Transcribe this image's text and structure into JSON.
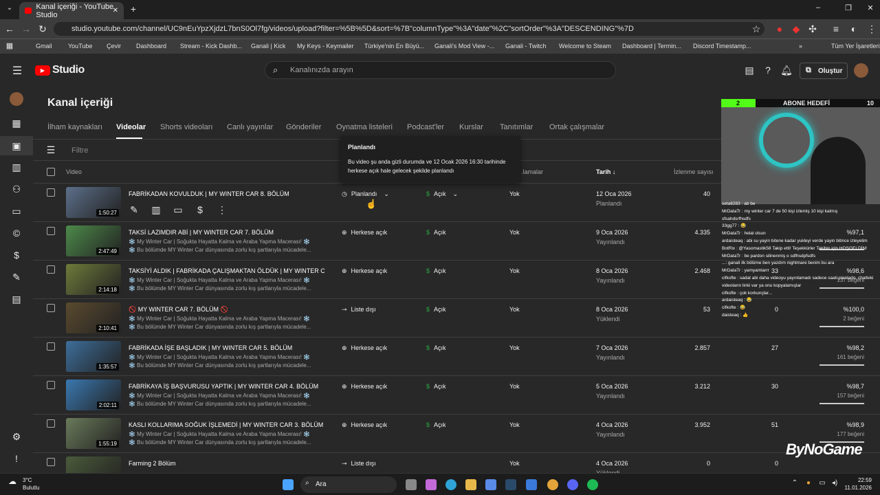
{
  "browser": {
    "tab_title": "Kanal içeriği - YouTube Studio",
    "url": "studio.youtube.com/channel/UC9nEuYpzXjdzL7bnS0Ol7fg/videos/upload?filter=%5B%5D&sort=%7B\"columnType\"%3A\"date\"%2C\"sortOrder\"%3A\"DESCENDING\"%7D",
    "bookmarks": [
      "Gmail",
      "YouTube",
      "Çevir",
      "Dashboard",
      "Stream - Kick Dashb...",
      "Ganali | Kick",
      "My Keys - Keymailer",
      "Türkiye'nin En Büyü...",
      "Ganali's Mod View -...",
      "Ganali - Twitch",
      "Welcome to Steam",
      "Dashboard | Termin...",
      "Discord Timestamp..."
    ],
    "bookmarks_more": "Tüm Yer İşaretleri"
  },
  "header": {
    "logo": "Studio",
    "search_placeholder": "Kanalınızda arayın",
    "create_label": "Oluştur"
  },
  "page": {
    "title": "Kanal içeriği",
    "tabs": [
      "İlham kaynakları",
      "Videolar",
      "Shorts videoları",
      "Canlı yayınlar",
      "Gönderiler",
      "Oynatma listeleri",
      "Podcast'ler",
      "Kurslar",
      "Tanıtımlar",
      "Ortak çalışmalar"
    ],
    "filter_placeholder": "Filtre"
  },
  "columns": {
    "video": "Video",
    "restrictions": "...lamalar",
    "date": "Tarih",
    "views": "İzlenme sayısı"
  },
  "tooltip": {
    "title": "Planlandı",
    "body": "Bu video şu anda gizli durumda ve 12 Ocak 2026 16:30 tarihinde herkese açık hale gelecek şekilde planlandı"
  },
  "rows": [
    {
      "title": "FABRİKADAN KOVULDUK | MY WINTER CAR 8. BÖLÜM",
      "desc1": "",
      "desc2": "",
      "duration": "1:50:27",
      "visibility": "Planlandı",
      "monet": "Açık",
      "restriction": "Yok",
      "date": "12 Oca 2026",
      "date_status": "Planlandı",
      "views": "40",
      "comments": "",
      "likes": "",
      "likes_sub": "",
      "thumb": "#5c6f8a"
    },
    {
      "title": "TAKSİ LAZIMDIR ABİ | MY WINTER CAR 7. BÖLÜM",
      "desc1": "❄️ My Winter Car | Soğukta Hayatta Kalma ve Araba Yapma Macerası! ❄️",
      "desc2": "❄️ Bu bölümde MY Winter Car dünyasında zorlu kış şartlarıyla mücadele...",
      "duration": "2:47:49",
      "visibility": "Herkese açık",
      "monet": "Açık",
      "restriction": "Yok",
      "date": "9 Oca 2026",
      "date_status": "Yayınlandı",
      "views": "4.335",
      "comments": "",
      "likes": "%97,1",
      "likes_sub": "",
      "thumb": "#4d8a4a"
    },
    {
      "title": "TAKSİYİ ALDIK | FABRİKADA ÇALIŞMAKTAN ÖLDÜK | MY WINTER CAR ...",
      "desc1": "❄️ My Winter Car | Soğukta Hayatta Kalma ve Araba Yapma Macerası! ❄️",
      "desc2": "❄️ Bu bölümde MY Winter Car dünyasında zorlu kış şartlarıyla mücadele...",
      "duration": "2:14:18",
      "visibility": "Herkese açık",
      "monet": "Açık",
      "restriction": "Yok",
      "date": "8 Oca 2026",
      "date_status": "Yayınlandı",
      "views": "2.468",
      "comments": "33",
      "likes": "%98,6",
      "likes_sub": "137 beğeni",
      "thumb": "#6e7a3a"
    },
    {
      "title": "🚫 MY WINTER CAR 7. BÖLÜM 🚫",
      "desc1": "❄️ My Winter Car | Soğukta Hayatta Kalma ve Araba Yapma Macerası! ❄️",
      "desc2": "❄️ Bu bölümde MY Winter Car dünyasında zorlu kış şartlarıyla mücadele...",
      "duration": "2:10:41",
      "visibility": "Liste dışı",
      "monet": "Açık",
      "restriction": "Yok",
      "date": "8 Oca 2026",
      "date_status": "Yüklendi",
      "views": "53",
      "comments": "0",
      "likes": "%100,0",
      "likes_sub": "2 beğeni",
      "thumb": "#5a4a2e"
    },
    {
      "title": "FABRİKADA İŞE BAŞLADIK | MY WINTER CAR 5. BÖLÜM",
      "desc1": "❄️ My Winter Car | Soğukta Hayatta Kalma ve Araba Yapma Macerası! ❄️",
      "desc2": "❄️ Bu bölümde MY Winter Car dünyasında zorlu kış şartlarıyla mücadele...",
      "duration": "1:35:57",
      "visibility": "Herkese açık",
      "monet": "Açık",
      "restriction": "Yok",
      "date": "7 Oca 2026",
      "date_status": "Yayınlandı",
      "views": "2.857",
      "comments": "27",
      "likes": "%98,2",
      "likes_sub": "161 beğeni",
      "thumb": "#3d6e9a"
    },
    {
      "title": "FABRİKAYA İŞ BAŞVURUSU YAPTIK | MY WINTER CAR 4. BÖLÜM",
      "desc1": "❄️ My Winter Car | Soğukta Hayatta Kalma ve Araba Yapma Macerası! ❄️",
      "desc2": "❄️ Bu bölümde MY Winter Car dünyasında zorlu kış şartlarıyla mücadele...",
      "duration": "2:02:11",
      "visibility": "Herkese açık",
      "monet": "Açık",
      "restriction": "Yok",
      "date": "5 Oca 2026",
      "date_status": "Yayınlandı",
      "views": "3.212",
      "comments": "30",
      "likes": "%98,7",
      "likes_sub": "157 beğeni",
      "thumb": "#3a78b0"
    },
    {
      "title": "KASLI KOLLARIMA SOĞUK İŞLEMEDİ | MY WINTER CAR 3. BÖLÜM",
      "desc1": "❄️ My Winter Car | Soğukta Hayatta Kalma ve Araba Yapma Macerası! ❄️",
      "desc2": "❄️ Bu bölümde MY Winter Car dünyasında zorlu kış şartlarıyla mücadele...",
      "duration": "1:55:19",
      "visibility": "Herkese açık",
      "monet": "Açık",
      "restriction": "Yok",
      "date": "4 Oca 2026",
      "date_status": "Yayınlandı",
      "views": "3.952",
      "comments": "51",
      "likes": "%98,9",
      "likes_sub": "177 beğeni",
      "thumb": "#6a7a5a"
    },
    {
      "title": "Farming 2 Bölüm",
      "desc1": "",
      "desc2": "",
      "duration": "",
      "visibility": "Liste dışı",
      "monet": "",
      "restriction": "Yok",
      "date": "4 Oca 2026",
      "date_status": "Yüklendi",
      "views": "0",
      "comments": "0",
      "likes": "",
      "likes_sub": "",
      "thumb": "#4a5a3a"
    }
  ],
  "stream": {
    "goal_left": "2",
    "goal_label": "ABONE HEDEFİ",
    "goal_right": "10",
    "chat": [
      "seta8283 : ab be",
      "MrDataTr : my winter car 7 de 50 kişi izlemiş 10 kişi kalmış",
      "sfsahdsrfhsdfs",
      "33gg77 : 😂",
      "MrDataTr : helal olsun",
      "ardaisteaq : abi su yayin bitene kadar yukleyi verde yayin bitince izleyelim",
      "BotRix : @Yasomastik58 Takip etti! Teşekkürler Takibin için HOŞGELDİN!",
      "MrDataTr : be pardon silinenmiş o sdfhsdpfsdfs",
      "...: ganali ilk bölüme ben yazdım nightmare benim bu ara",
      "MrDataTr : yamyamlarrr",
      "cifkofte : sadat abi daha videoyu yayınlamadı sadece saati planlado, chatteki",
      "videoların linki var ya onu kopyalamışlar",
      "cifkofte : çok korkunçlar...",
      "ardaisteaq : 😂",
      "cifkofte : 😂",
      "daisteaq : 👍"
    ],
    "brand": "ByNoGame"
  },
  "taskbar": {
    "weather_temp": "3°C",
    "weather_desc": "Bulutlu",
    "search_placeholder": "Ara",
    "time": "22:59",
    "date": "11.01.2026"
  }
}
